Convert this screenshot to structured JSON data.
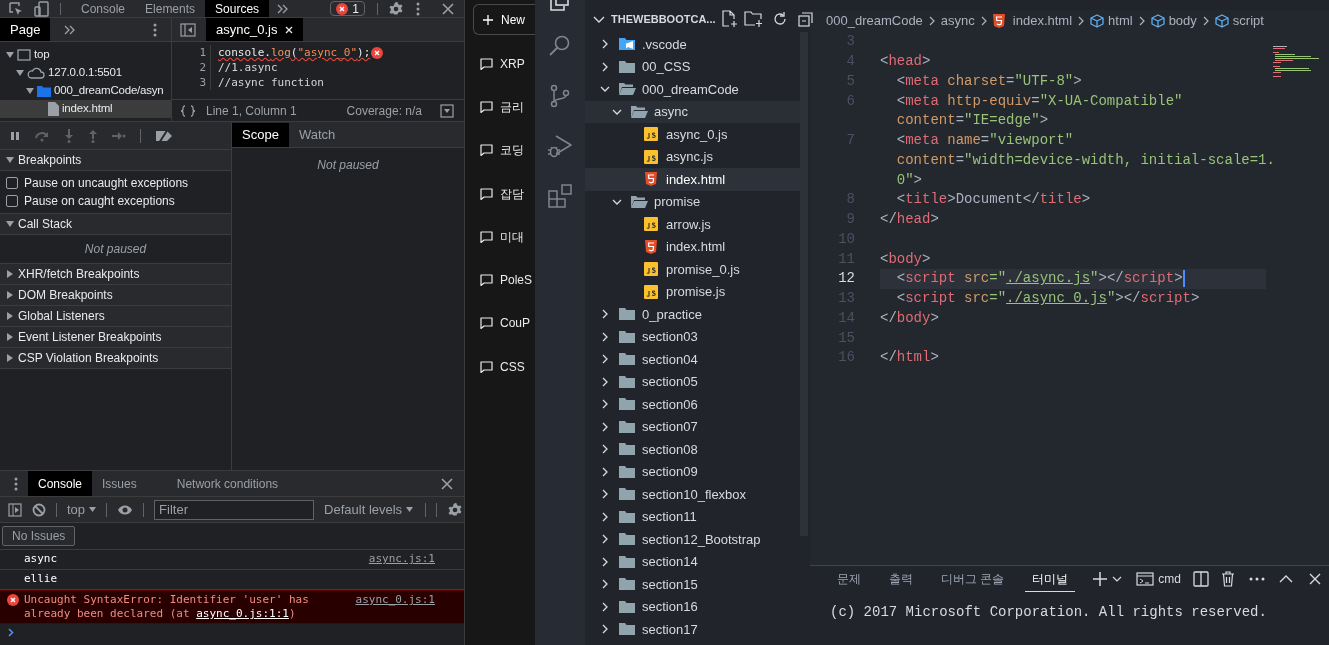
{
  "devtools": {
    "main_tabs": [
      {
        "label": "Console",
        "selected": false
      },
      {
        "label": "Elements",
        "selected": false
      },
      {
        "label": "Sources",
        "selected": true
      }
    ],
    "error_count": "1",
    "navigator": {
      "tabs": [
        {
          "label": "Page",
          "selected": true
        }
      ],
      "tree": [
        {
          "label": "top",
          "kind": "frame",
          "expanded": true,
          "selected": false,
          "children": [
            {
              "label": "127.0.0.1:5501",
              "kind": "origin",
              "expanded": true,
              "selected": false,
              "children": [
                {
                  "label": "000_dreamCode/asyn",
                  "kind": "folder",
                  "expanded": true,
                  "selected": false,
                  "children": [
                    {
                      "label": "index.html",
                      "kind": "file",
                      "selected": true
                    }
                  ]
                }
              ]
            }
          ]
        }
      ]
    },
    "editor": {
      "tabs": [
        {
          "label": "async_0.js",
          "selected": true
        }
      ],
      "lines": [
        {
          "number": "1",
          "error": true,
          "tokens": [
            {
              "text": "console.",
              "kind": "plain"
            },
            {
              "text": "log",
              "kind": "fn"
            },
            {
              "text": "(",
              "kind": "plain"
            },
            {
              "text": "\"async_0\"",
              "kind": "string"
            },
            {
              "text": ");",
              "kind": "plain"
            }
          ]
        },
        {
          "number": "2",
          "error": false,
          "tokens": [
            {
              "text": "//1.async",
              "kind": "comment"
            }
          ]
        },
        {
          "number": "3",
          "error": false,
          "tokens": [
            {
              "text": "//async function",
              "kind": "comment"
            }
          ]
        }
      ],
      "position": "Line 1, Column 1",
      "coverage": "Coverage: n/a"
    },
    "sidebar_tabs": [
      {
        "label": "Scope",
        "selected": true
      },
      {
        "label": "Watch",
        "selected": false
      }
    ],
    "scope_message": "Not paused",
    "sections": [
      {
        "title": "Breakpoints",
        "expanded": true,
        "options": [
          {
            "label": "Pause on uncaught exceptions",
            "checked": false
          },
          {
            "label": "Pause on caught exceptions",
            "checked": false
          }
        ]
      },
      {
        "title": "Call Stack",
        "expanded": true,
        "message": "Not paused"
      },
      {
        "title": "XHR/fetch Breakpoints",
        "expanded": false
      },
      {
        "title": "DOM Breakpoints",
        "expanded": false
      },
      {
        "title": "Global Listeners",
        "expanded": false
      },
      {
        "title": "Event Listener Breakpoints",
        "expanded": false
      },
      {
        "title": "CSP Violation Breakpoints",
        "expanded": false
      }
    ],
    "drawer": {
      "tabs": [
        {
          "label": "Console",
          "selected": true
        },
        {
          "label": "Issues",
          "selected": false
        },
        {
          "label": "Network conditions",
          "selected": false
        }
      ],
      "context": "top",
      "filter_placeholder": "Filter",
      "levels": "Default levels",
      "issues": "No Issues",
      "messages": [
        {
          "kind": "log",
          "text": "async",
          "source": "async.js:1"
        },
        {
          "kind": "log",
          "text": "ellie"
        },
        {
          "kind": "error",
          "text": "Uncaught SyntaxError: Identifier 'user' has already been declared (at ",
          "link": "async_0.js:1:1",
          "after": ")",
          "source": "async_0.js:1"
        }
      ]
    }
  },
  "chat_sidebar": {
    "new_button": "New",
    "items": [
      "XRP",
      "금리",
      "코딩",
      "잡담",
      "미대",
      "PoleS",
      "CouP",
      "CSS"
    ]
  },
  "activity_bar": [
    {
      "kind": "explorer",
      "selected": true
    },
    {
      "kind": "search",
      "selected": false
    },
    {
      "kind": "source-control",
      "selected": false
    },
    {
      "kind": "debug",
      "selected": false
    },
    {
      "kind": "extensions",
      "selected": false
    }
  ],
  "explorer": {
    "title": "THEWEBBOOTCA...",
    "tree": [
      {
        "name": ".vscode",
        "kind": "vscode",
        "expanded": false,
        "selected": false,
        "hovered": false
      },
      {
        "name": "00_CSS",
        "kind": "folder",
        "expanded": false,
        "selected": false,
        "hovered": false
      },
      {
        "name": "000_dreamCode",
        "kind": "folder",
        "expanded": true,
        "selected": false,
        "hovered": false,
        "children": [
          {
            "name": "async",
            "kind": "folder",
            "expanded": true,
            "selected": false,
            "hovered": true,
            "children": [
              {
                "name": "async_0.js",
                "kind": "js",
                "selected": false,
                "hovered": false
              },
              {
                "name": "async.js",
                "kind": "js",
                "selected": false,
                "hovered": false
              },
              {
                "name": "index.html",
                "kind": "html",
                "selected": true,
                "hovered": false
              }
            ]
          },
          {
            "name": "promise",
            "kind": "folder",
            "expanded": true,
            "selected": false,
            "hovered": false,
            "children": [
              {
                "name": "arrow.js",
                "kind": "js",
                "selected": false,
                "hovered": false
              },
              {
                "name": "index.html",
                "kind": "html",
                "selected": false,
                "hovered": false
              },
              {
                "name": "promise_0.js",
                "kind": "js",
                "selected": false,
                "hovered": false
              },
              {
                "name": "promise.js",
                "kind": "js",
                "selected": false,
                "hovered": false
              }
            ]
          }
        ]
      },
      {
        "name": "0_practice",
        "kind": "folder",
        "expanded": false,
        "selected": false,
        "hovered": false
      },
      {
        "name": "section03",
        "kind": "folder",
        "expanded": false,
        "selected": false,
        "hovered": false
      },
      {
        "name": "section04",
        "kind": "folder",
        "expanded": false,
        "selected": false,
        "hovered": false
      },
      {
        "name": "section05",
        "kind": "folder",
        "expanded": false,
        "selected": false,
        "hovered": false
      },
      {
        "name": "section06",
        "kind": "folder",
        "expanded": false,
        "selected": false,
        "hovered": false
      },
      {
        "name": "section07",
        "kind": "folder",
        "expanded": false,
        "selected": false,
        "hovered": false
      },
      {
        "name": "section08",
        "kind": "folder",
        "expanded": false,
        "selected": false,
        "hovered": false
      },
      {
        "name": "section09",
        "kind": "folder",
        "expanded": false,
        "selected": false,
        "hovered": false
      },
      {
        "name": "section10_flexbox",
        "kind": "folder",
        "expanded": false,
        "selected": false,
        "hovered": false
      },
      {
        "name": "section11",
        "kind": "folder",
        "expanded": false,
        "selected": false,
        "hovered": false
      },
      {
        "name": "section12_Bootstrap",
        "kind": "folder",
        "expanded": false,
        "selected": false,
        "hovered": false
      },
      {
        "name": "section14",
        "kind": "folder",
        "expanded": false,
        "selected": false,
        "hovered": false
      },
      {
        "name": "section15",
        "kind": "folder",
        "expanded": false,
        "selected": false,
        "hovered": false
      },
      {
        "name": "section16",
        "kind": "folder",
        "expanded": false,
        "selected": false,
        "hovered": false
      },
      {
        "name": "section17",
        "kind": "folder",
        "expanded": false,
        "selected": false,
        "hovered": false
      }
    ]
  },
  "editor": {
    "breadcrumb": [
      {
        "label": "000_dreamCode",
        "kind": "folder"
      },
      {
        "label": "async",
        "kind": "folder"
      },
      {
        "label": "index.html",
        "kind": "html"
      },
      {
        "label": "html",
        "kind": "element"
      },
      {
        "label": "body",
        "kind": "element"
      },
      {
        "label": "script",
        "kind": "element"
      }
    ],
    "rows": [
      {
        "number": "3",
        "current": false,
        "tokens": []
      },
      {
        "number": "4",
        "current": false,
        "tokens": [
          {
            "text": "<",
            "kind": "punct"
          },
          {
            "text": "head",
            "kind": "tag"
          },
          {
            "text": ">",
            "kind": "punct"
          }
        ]
      },
      {
        "number": "5",
        "current": false,
        "tokens": [
          {
            "text": "  <",
            "kind": "punct"
          },
          {
            "text": "meta",
            "kind": "tag"
          },
          {
            "text": " charset",
            "kind": "attr"
          },
          {
            "text": "=",
            "kind": "punct"
          },
          {
            "text": "\"UTF-8\"",
            "kind": "string"
          },
          {
            "text": ">",
            "kind": "punct"
          }
        ]
      },
      {
        "number": "6",
        "current": false,
        "tokens": [
          {
            "text": "  <",
            "kind": "punct"
          },
          {
            "text": "meta",
            "kind": "tag"
          },
          {
            "text": " http-equiv",
            "kind": "attr"
          },
          {
            "text": "=",
            "kind": "punct"
          },
          {
            "text": "\"X-UA-Compatible\"",
            "kind": "string"
          }
        ]
      },
      {
        "current": false,
        "tokens": [
          {
            "text": "  content",
            "kind": "attr"
          },
          {
            "text": "=",
            "kind": "punct"
          },
          {
            "text": "\"IE=edge\"",
            "kind": "string"
          },
          {
            "text": ">",
            "kind": "punct"
          }
        ]
      },
      {
        "number": "7",
        "current": false,
        "tokens": [
          {
            "text": "  <",
            "kind": "punct"
          },
          {
            "text": "meta",
            "kind": "tag"
          },
          {
            "text": " name",
            "kind": "attr"
          },
          {
            "text": "=",
            "kind": "punct"
          },
          {
            "text": "\"viewport\"",
            "kind": "string"
          }
        ]
      },
      {
        "current": false,
        "tokens": [
          {
            "text": "  content",
            "kind": "attr"
          },
          {
            "text": "=",
            "kind": "punct"
          },
          {
            "text": "\"width=device-width, initial-scale=1.",
            "kind": "string"
          }
        ]
      },
      {
        "current": false,
        "tokens": [
          {
            "text": "  0\"",
            "kind": "string"
          },
          {
            "text": ">",
            "kind": "punct"
          }
        ]
      },
      {
        "number": "8",
        "current": false,
        "tokens": [
          {
            "text": "  <",
            "kind": "punct"
          },
          {
            "text": "title",
            "kind": "tag"
          },
          {
            "text": ">",
            "kind": "punct"
          },
          {
            "text": "Document",
            "kind": "text"
          },
          {
            "text": "</",
            "kind": "punct"
          },
          {
            "text": "title",
            "kind": "tag"
          },
          {
            "text": ">",
            "kind": "punct"
          }
        ]
      },
      {
        "number": "9",
        "current": false,
        "tokens": [
          {
            "text": "</",
            "kind": "punct"
          },
          {
            "text": "head",
            "kind": "tag"
          },
          {
            "text": ">",
            "kind": "punct"
          }
        ]
      },
      {
        "number": "10",
        "current": false,
        "tokens": []
      },
      {
        "number": "11",
        "current": false,
        "tokens": [
          {
            "text": "<",
            "kind": "punct"
          },
          {
            "text": "body",
            "kind": "tag"
          },
          {
            "text": ">",
            "kind": "punct"
          }
        ]
      },
      {
        "number": "12",
        "current": true,
        "tokens": [
          {
            "text": "  <",
            "kind": "punct"
          },
          {
            "text": "script",
            "kind": "tag"
          },
          {
            "text": " src",
            "kind": "attr"
          },
          {
            "text": "=\"",
            "kind": "string"
          },
          {
            "text": "./async.js",
            "kind": "link"
          },
          {
            "text": "\"",
            "kind": "string"
          },
          {
            "text": "></",
            "kind": "punct"
          },
          {
            "text": "script",
            "kind": "tag"
          },
          {
            "text": ">",
            "kind": "punct"
          }
        ]
      },
      {
        "number": "13",
        "current": false,
        "tokens": [
          {
            "text": "  <",
            "kind": "punct"
          },
          {
            "text": "script",
            "kind": "tag"
          },
          {
            "text": " src",
            "kind": "attr"
          },
          {
            "text": "=\"",
            "kind": "string"
          },
          {
            "text": "./async_0.js",
            "kind": "link"
          },
          {
            "text": "\"",
            "kind": "string"
          },
          {
            "text": "></",
            "kind": "punct"
          },
          {
            "text": "script",
            "kind": "tag"
          },
          {
            "text": ">",
            "kind": "punct"
          }
        ]
      },
      {
        "number": "14",
        "current": false,
        "tokens": [
          {
            "text": "</",
            "kind": "punct"
          },
          {
            "text": "body",
            "kind": "tag"
          },
          {
            "text": ">",
            "kind": "punct"
          }
        ]
      },
      {
        "number": "15",
        "current": false,
        "tokens": []
      },
      {
        "number": "16",
        "current": false,
        "tokens": [
          {
            "text": "</",
            "kind": "punct"
          },
          {
            "text": "html",
            "kind": "tag"
          },
          {
            "text": ">",
            "kind": "punct"
          }
        ]
      }
    ]
  },
  "panel": {
    "tabs": [
      {
        "label": "문제",
        "selected": false
      },
      {
        "label": "출력",
        "selected": false
      },
      {
        "label": "디버그 콘솔",
        "selected": false
      },
      {
        "label": "터미널",
        "selected": true
      }
    ],
    "shell": "cmd",
    "output": [
      "(c) 2017 Microsoft Corporation. All rights reserved."
    ]
  }
}
